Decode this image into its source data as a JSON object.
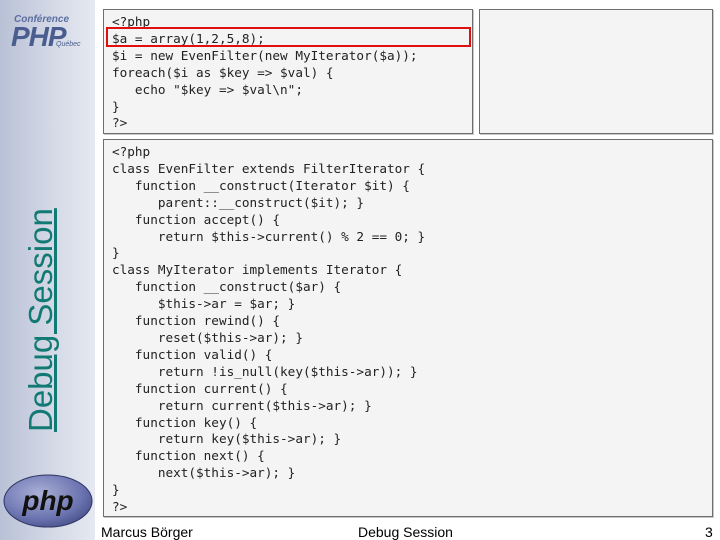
{
  "sidebar": {
    "logo_word": "Conférence",
    "logo_php": "PHP",
    "logo_city": "Québec",
    "vertical_title": "Debug Session"
  },
  "panels": {
    "top_code": [
      "<?php",
      "$a = array(1,2,5,8);",
      "$i = new EvenFilter(new MyIterator($a));",
      "foreach($i as $key => $val) {",
      "   echo \"$key => $val\\n\";",
      "}",
      "?>"
    ],
    "main_code": [
      "<?php",
      "class EvenFilter extends FilterIterator {",
      "   function __construct(Iterator $it) {",
      "      parent::__construct($it); }",
      "   function accept() {",
      "      return $this->current() % 2 == 0; }",
      "}",
      "class MyIterator implements Iterator {",
      "   function __construct($ar) {",
      "      $this->ar = $ar; }",
      "   function rewind() {",
      "      reset($this->ar); }",
      "   function valid() {",
      "      return !is_null(key($this->ar)); }",
      "   function current() {",
      "      return current($this->ar); }",
      "   function key() {",
      "      return key($this->ar); }",
      "   function next() {",
      "      next($this->ar); }",
      "}",
      "?>"
    ]
  },
  "footer": {
    "author": "Marcus Börger",
    "title": "Debug Session",
    "page": "3"
  },
  "colors": {
    "title": "#127a74",
    "highlight": "#e01010",
    "panel_bg": "#f4f4f4"
  },
  "icons": [
    "php-conference-logo",
    "php-logo"
  ]
}
